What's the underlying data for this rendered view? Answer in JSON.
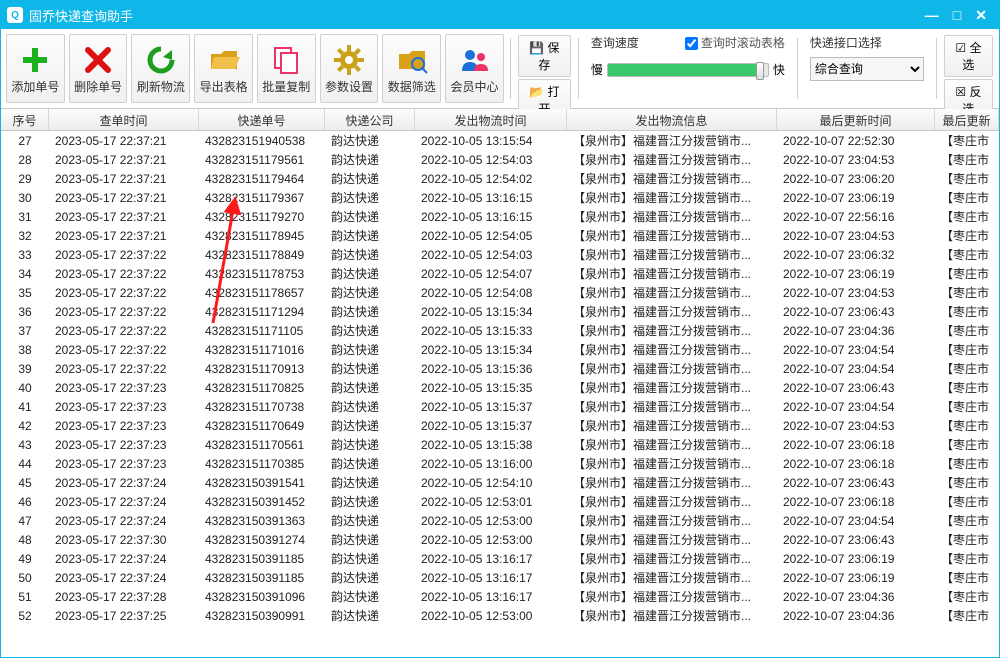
{
  "window": {
    "title": "固乔快递查询助手"
  },
  "toolbar_buttons": [
    {
      "label": "添加单号",
      "icon": "plus",
      "color": "#1db11d"
    },
    {
      "label": "删除单号",
      "icon": "x",
      "color": "#d11"
    },
    {
      "label": "刷新物流",
      "icon": "refresh",
      "color": "#1d9e1d"
    },
    {
      "label": "导出表格",
      "icon": "folder",
      "color": "#d9a11a"
    },
    {
      "label": "批量复制",
      "icon": "copy",
      "color": "#e36"
    },
    {
      "label": "参数设置",
      "icon": "gear",
      "color": "#c9a21a"
    },
    {
      "label": "数据筛选",
      "icon": "filter",
      "color": "#d9a11a"
    },
    {
      "label": "会员中心",
      "icon": "users",
      "color": "#1d6fd9"
    }
  ],
  "small_buttons_left": {
    "save": "保存",
    "open": "打开"
  },
  "speed": {
    "title": "查询速度",
    "scroll_check": "查询时滚动表格",
    "slow": "慢",
    "fast": "快"
  },
  "iface": {
    "title": "快递接口选择",
    "selected": "综合查询"
  },
  "small_buttons_right": {
    "all": "全选",
    "inv": "反选"
  },
  "columns": [
    "序号",
    "查单时间",
    "快递单号",
    "快递公司",
    "发出物流时间",
    "发出物流信息",
    "最后更新时间",
    "最后更新"
  ],
  "rows": [
    {
      "n": "27",
      "t": "2023-05-17 22:37:21",
      "num": "432823151940538",
      "co": "韵达快递",
      "out": "2022-10-05 13:15:54",
      "info": "【泉州市】福建晋江分拨营销市...",
      "upd": "2022-10-07 22:52:30",
      "last": "【枣庄市"
    },
    {
      "n": "28",
      "t": "2023-05-17 22:37:21",
      "num": "432823151179561",
      "co": "韵达快递",
      "out": "2022-10-05 12:54:03",
      "info": "【泉州市】福建晋江分拨营销市...",
      "upd": "2022-10-07 23:04:53",
      "last": "【枣庄市"
    },
    {
      "n": "29",
      "t": "2023-05-17 22:37:21",
      "num": "432823151179464",
      "co": "韵达快递",
      "out": "2022-10-05 12:54:02",
      "info": "【泉州市】福建晋江分拨营销市...",
      "upd": "2022-10-07 23:06:20",
      "last": "【枣庄市"
    },
    {
      "n": "30",
      "t": "2023-05-17 22:37:21",
      "num": "432823151179367",
      "co": "韵达快递",
      "out": "2022-10-05 13:16:15",
      "info": "【泉州市】福建晋江分拨营销市...",
      "upd": "2022-10-07 23:06:19",
      "last": "【枣庄市"
    },
    {
      "n": "31",
      "t": "2023-05-17 22:37:21",
      "num": "432823151179270",
      "co": "韵达快递",
      "out": "2022-10-05 13:16:15",
      "info": "【泉州市】福建晋江分拨营销市...",
      "upd": "2022-10-07 22:56:16",
      "last": "【枣庄市"
    },
    {
      "n": "32",
      "t": "2023-05-17 22:37:21",
      "num": "432823151178945",
      "co": "韵达快递",
      "out": "2022-10-05 12:54:05",
      "info": "【泉州市】福建晋江分拨营销市...",
      "upd": "2022-10-07 23:04:53",
      "last": "【枣庄市"
    },
    {
      "n": "33",
      "t": "2023-05-17 22:37:22",
      "num": "432823151178849",
      "co": "韵达快递",
      "out": "2022-10-05 12:54:03",
      "info": "【泉州市】福建晋江分拨营销市...",
      "upd": "2022-10-07 23:06:32",
      "last": "【枣庄市"
    },
    {
      "n": "34",
      "t": "2023-05-17 22:37:22",
      "num": "432823151178753",
      "co": "韵达快递",
      "out": "2022-10-05 12:54:07",
      "info": "【泉州市】福建晋江分拨营销市...",
      "upd": "2022-10-07 23:06:19",
      "last": "【枣庄市"
    },
    {
      "n": "35",
      "t": "2023-05-17 22:37:22",
      "num": "432823151178657",
      "co": "韵达快递",
      "out": "2022-10-05 12:54:08",
      "info": "【泉州市】福建晋江分拨营销市...",
      "upd": "2022-10-07 23:04:53",
      "last": "【枣庄市"
    },
    {
      "n": "36",
      "t": "2023-05-17 22:37:22",
      "num": "432823151171294",
      "co": "韵达快递",
      "out": "2022-10-05 13:15:34",
      "info": "【泉州市】福建晋江分拨营销市...",
      "upd": "2022-10-07 23:06:43",
      "last": "【枣庄市"
    },
    {
      "n": "37",
      "t": "2023-05-17 22:37:22",
      "num": "432823151171105",
      "co": "韵达快递",
      "out": "2022-10-05 13:15:33",
      "info": "【泉州市】福建晋江分拨营销市...",
      "upd": "2022-10-07 23:04:36",
      "last": "【枣庄市"
    },
    {
      "n": "38",
      "t": "2023-05-17 22:37:22",
      "num": "432823151171016",
      "co": "韵达快递",
      "out": "2022-10-05 13:15:34",
      "info": "【泉州市】福建晋江分拨营销市...",
      "upd": "2022-10-07 23:04:54",
      "last": "【枣庄市"
    },
    {
      "n": "39",
      "t": "2023-05-17 22:37:22",
      "num": "432823151170913",
      "co": "韵达快递",
      "out": "2022-10-05 13:15:36",
      "info": "【泉州市】福建晋江分拨营销市...",
      "upd": "2022-10-07 23:04:54",
      "last": "【枣庄市"
    },
    {
      "n": "40",
      "t": "2023-05-17 22:37:23",
      "num": "432823151170825",
      "co": "韵达快递",
      "out": "2022-10-05 13:15:35",
      "info": "【泉州市】福建晋江分拨营销市...",
      "upd": "2022-10-07 23:06:43",
      "last": "【枣庄市"
    },
    {
      "n": "41",
      "t": "2023-05-17 22:37:23",
      "num": "432823151170738",
      "co": "韵达快递",
      "out": "2022-10-05 13:15:37",
      "info": "【泉州市】福建晋江分拨营销市...",
      "upd": "2022-10-07 23:04:54",
      "last": "【枣庄市"
    },
    {
      "n": "42",
      "t": "2023-05-17 22:37:23",
      "num": "432823151170649",
      "co": "韵达快递",
      "out": "2022-10-05 13:15:37",
      "info": "【泉州市】福建晋江分拨营销市...",
      "upd": "2022-10-07 23:04:53",
      "last": "【枣庄市"
    },
    {
      "n": "43",
      "t": "2023-05-17 22:37:23",
      "num": "432823151170561",
      "co": "韵达快递",
      "out": "2022-10-05 13:15:38",
      "info": "【泉州市】福建晋江分拨营销市...",
      "upd": "2022-10-07 23:06:18",
      "last": "【枣庄市"
    },
    {
      "n": "44",
      "t": "2023-05-17 22:37:23",
      "num": "432823151170385",
      "co": "韵达快递",
      "out": "2022-10-05 13:16:00",
      "info": "【泉州市】福建晋江分拨营销市...",
      "upd": "2022-10-07 23:06:18",
      "last": "【枣庄市"
    },
    {
      "n": "45",
      "t": "2023-05-17 22:37:24",
      "num": "432823150391541",
      "co": "韵达快递",
      "out": "2022-10-05 12:54:10",
      "info": "【泉州市】福建晋江分拨营销市...",
      "upd": "2022-10-07 23:06:43",
      "last": "【枣庄市"
    },
    {
      "n": "46",
      "t": "2023-05-17 22:37:24",
      "num": "432823150391452",
      "co": "韵达快递",
      "out": "2022-10-05 12:53:01",
      "info": "【泉州市】福建晋江分拨营销市...",
      "upd": "2022-10-07 23:06:18",
      "last": "【枣庄市"
    },
    {
      "n": "47",
      "t": "2023-05-17 22:37:24",
      "num": "432823150391363",
      "co": "韵达快递",
      "out": "2022-10-05 12:53:00",
      "info": "【泉州市】福建晋江分拨营销市...",
      "upd": "2022-10-07 23:04:54",
      "last": "【枣庄市"
    },
    {
      "n": "48",
      "t": "2023-05-17 22:37:30",
      "num": "432823150391274",
      "co": "韵达快递",
      "out": "2022-10-05 12:53:00",
      "info": "【泉州市】福建晋江分拨营销市...",
      "upd": "2022-10-07 23:06:43",
      "last": "【枣庄市"
    },
    {
      "n": "49",
      "t": "2023-05-17 22:37:24",
      "num": "432823150391185",
      "co": "韵达快递",
      "out": "2022-10-05 13:16:17",
      "info": "【泉州市】福建晋江分拨营销市...",
      "upd": "2022-10-07 23:06:19",
      "last": "【枣庄市"
    },
    {
      "n": "50",
      "t": "2023-05-17 22:37:24",
      "num": "432823150391185",
      "co": "韵达快递",
      "out": "2022-10-05 13:16:17",
      "info": "【泉州市】福建晋江分拨营销市...",
      "upd": "2022-10-07 23:06:19",
      "last": "【枣庄市"
    },
    {
      "n": "51",
      "t": "2023-05-17 22:37:28",
      "num": "432823150391096",
      "co": "韵达快递",
      "out": "2022-10-05 13:16:17",
      "info": "【泉州市】福建晋江分拨营销市...",
      "upd": "2022-10-07 23:04:36",
      "last": "【枣庄市"
    },
    {
      "n": "52",
      "t": "2023-05-17 22:37:25",
      "num": "432823150390991",
      "co": "韵达快递",
      "out": "2022-10-05 12:53:00",
      "info": "【泉州市】福建晋江分拨营销市...",
      "upd": "2022-10-07 23:04:36",
      "last": "【枣庄市"
    }
  ]
}
